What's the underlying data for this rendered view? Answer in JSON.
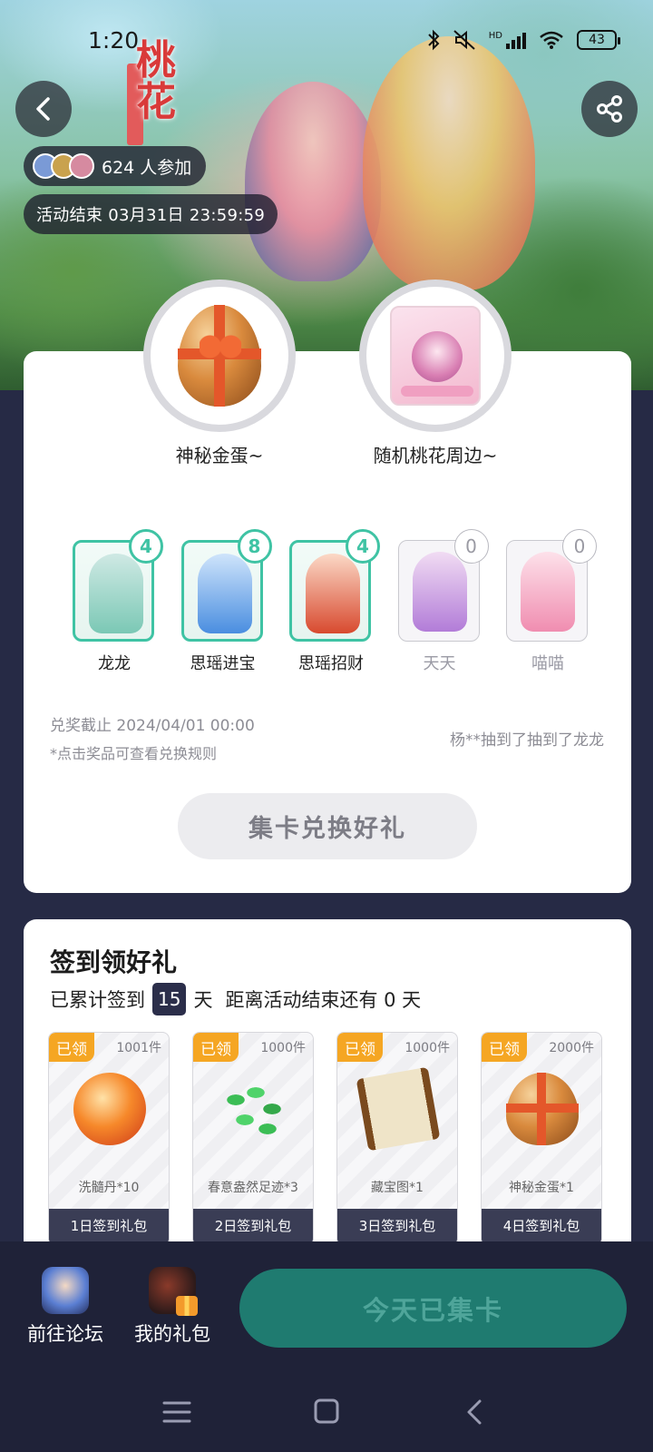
{
  "status_bar": {
    "time": "1:20",
    "battery": "43",
    "network_tag": "HD"
  },
  "hero": {
    "title_mark": "桃花"
  },
  "header": {
    "back_icon": "chevron-left-icon",
    "share_icon": "share-icon",
    "participants_text": "624 人参加",
    "end_time_text": "活动结束 03月31日 23:59:59"
  },
  "prizes": [
    {
      "name": "神秘金蛋~"
    },
    {
      "name": "随机桃花周边~"
    }
  ],
  "cards": [
    {
      "name": "龙龙",
      "count": "4",
      "owned": true,
      "colors": [
        "#cfe9e4",
        "#7bc8b5"
      ]
    },
    {
      "name": "思瑶进宝",
      "count": "8",
      "owned": true,
      "colors": [
        "#cfe4fb",
        "#4a8ee0"
      ]
    },
    {
      "name": "思瑶招财",
      "count": "4",
      "owned": true,
      "colors": [
        "#fbd9c7",
        "#d84a2f"
      ]
    },
    {
      "name": "天天",
      "count": "0",
      "owned": false,
      "colors": [
        "#f1dcf3",
        "#b27cd8"
      ]
    },
    {
      "name": "喵喵",
      "count": "0",
      "owned": false,
      "colors": [
        "#fde1ea",
        "#f08db0"
      ]
    }
  ],
  "exchange": {
    "deadline": "兑奖截止 2024/04/01 00:00",
    "rule_tip": "*点击奖品可查看兑换规则",
    "draw_news": "杨**抽到了抽到了龙龙",
    "button_label": "集卡兑换好礼"
  },
  "sign_in": {
    "title": "签到领好礼",
    "prefix": "已累计签到",
    "days": "15",
    "unit": "天",
    "remaining_text": "距离活动结束还有 0 天",
    "gifts": [
      {
        "tag": "已领",
        "qty": "1001件",
        "name": "洗髓丹*10",
        "footer": "1日签到礼包",
        "art": "pill"
      },
      {
        "tag": "已领",
        "qty": "1000件",
        "name": "春意盎然足迹*3",
        "footer": "2日签到礼包",
        "art": "leaves"
      },
      {
        "tag": "已领",
        "qty": "1000件",
        "name": "藏宝图*1",
        "footer": "3日签到礼包",
        "art": "scroll"
      },
      {
        "tag": "已领",
        "qty": "2000件",
        "name": "神秘金蛋*1",
        "footer": "4日签到礼包",
        "art": "egg"
      }
    ]
  },
  "bottom_bar": {
    "forum_label": "前往论坛",
    "gift_label": "我的礼包",
    "collect_button": "今天已集卡"
  },
  "system_nav": {
    "menu_icon": "menu-icon",
    "home_icon": "home-icon",
    "back_icon": "back-icon"
  }
}
